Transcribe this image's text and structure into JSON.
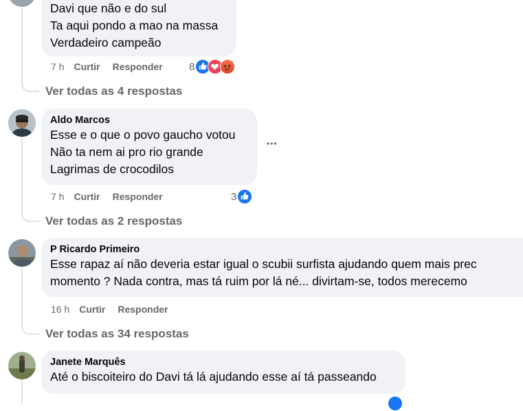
{
  "comments": [
    {
      "lines": [
        "Davi que não e do sul",
        "Ta aqui pondo a mao na massa",
        "Verdadeiro campeão"
      ],
      "time": "7 h",
      "like_label": "Curtir",
      "reply_label": "Responder",
      "reaction_count": "8",
      "reactions": [
        "like-icon",
        "love-icon",
        "angry-icon"
      ],
      "view_replies": "Ver todas as 4 respostas"
    },
    {
      "author": "Aldo Marcos",
      "lines": [
        "Esse e o que o povo gaucho votou",
        "Não ta nem ai pro rio grande",
        "Lagrimas de crocodilos"
      ],
      "time": "7 h",
      "like_label": "Curtir",
      "reply_label": "Responder",
      "reaction_count": "3",
      "reactions": [
        "like-icon"
      ],
      "more_label": "•••",
      "view_replies": "Ver todas as 2 respostas"
    },
    {
      "author": "P Ricardo Primeiro",
      "lines": [
        "Esse rapaz aí não deveria estar igual o scubii surfista ajudando quem mais prec",
        "momento ? Nada contra, mas tá ruim por lá né... divirtam-se, todos merecemo"
      ],
      "time": "16 h",
      "like_label": "Curtir",
      "reply_label": "Responder",
      "view_replies": "Ver todas as 34 respostas"
    },
    {
      "author": "Janete Marquês",
      "lines": [
        "Até o biscoiteiro do Davi tá lá ajudando esse aí tá passeando"
      ]
    }
  ]
}
